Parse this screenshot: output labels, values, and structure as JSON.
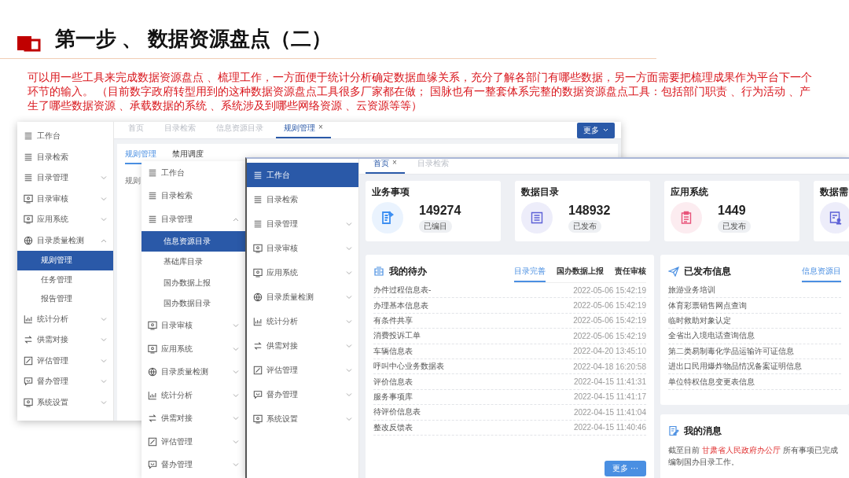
{
  "slide": {
    "title": "第一步 、 数据资源盘点（二）",
    "description": "可以用一些工具来完成数据资源盘点 、梳理工作，一方面便于统计分析确定数据血缘关系，充分了解各部门有哪些数据，另一方面需要把梳理成果作为平台下一个环节的输入。 （目前数字政府转型用到的这种数据资源盘点工具很多厂家都在做； 国脉也有一整套体系完整的数据资源盘点工具：包括部门职责 、行为活动 、产生了哪些数据资源 、承载数据的系统 、系统涉及到哪些网络资源 、云资源等等）"
  },
  "rule_window": {
    "tabs": [
      {
        "label": "首页",
        "selected": false
      },
      {
        "label": "目录检索",
        "selected": false
      },
      {
        "label": "信息资源目录",
        "selected": false
      },
      {
        "label": "规则管理",
        "close": "×",
        "selected": true
      }
    ],
    "more_button": "更多",
    "menu": [
      {
        "label": "工作台",
        "selected": false
      },
      {
        "label": "目录检索",
        "selected": false
      },
      {
        "label": "目录管理",
        "selected": false,
        "expanded": false
      },
      {
        "label": "目录审核",
        "selected": false,
        "expanded": false
      },
      {
        "label": "应用系统",
        "selected": false,
        "expanded": false
      },
      {
        "label": "目录质量检测",
        "selected": false,
        "expanded": true,
        "children": [
          {
            "label": "规则管理",
            "selected": true
          },
          {
            "label": "任务管理",
            "selected": false
          },
          {
            "label": "报告管理",
            "selected": false
          }
        ]
      },
      {
        "label": "统计分析",
        "selected": false,
        "expanded": false
      },
      {
        "label": "供需对接",
        "selected": false,
        "expanded": false
      },
      {
        "label": "评估管理",
        "selected": false,
        "expanded": false
      },
      {
        "label": "督办管理",
        "selected": false,
        "expanded": false
      },
      {
        "label": "系统设置",
        "selected": false,
        "expanded": false
      }
    ],
    "sub_tabs": [
      {
        "label": "规则管理",
        "selected": true
      },
      {
        "label": "禁用调度",
        "selected": false
      }
    ],
    "content_label": "规则"
  },
  "menu_panel": {
    "menu": [
      {
        "label": "工作台",
        "selected": false
      },
      {
        "label": "目录检索",
        "selected": false
      },
      {
        "label": "目录管理",
        "selected": false,
        "expanded": true,
        "children": [
          {
            "label": "信息资源目录",
            "selected": true
          },
          {
            "label": "基础库目录",
            "selected": false
          },
          {
            "label": "国办数据上报",
            "selected": false
          },
          {
            "label": "国办数据目录",
            "selected": false
          }
        ]
      },
      {
        "label": "目录审核",
        "selected": false,
        "expanded": false
      },
      {
        "label": "应用系统",
        "selected": false,
        "expanded": false
      },
      {
        "label": "目录质量检测",
        "selected": false,
        "expanded": false
      },
      {
        "label": "统计分析",
        "selected": false,
        "expanded": false
      },
      {
        "label": "供需对接",
        "selected": false,
        "expanded": false
      },
      {
        "label": "评估管理",
        "selected": false,
        "expanded": false
      },
      {
        "label": "督办管理",
        "selected": false,
        "expanded": false
      }
    ]
  },
  "home_window": {
    "menu": [
      {
        "label": "工作台",
        "selected": true
      },
      {
        "label": "目录检索",
        "selected": false
      },
      {
        "label": "目录管理",
        "selected": false,
        "expanded": false
      },
      {
        "label": "目录审核",
        "selected": false,
        "expanded": false
      },
      {
        "label": "应用系统",
        "selected": false,
        "expanded": false
      },
      {
        "label": "目录质量检测",
        "selected": false,
        "expanded": false
      },
      {
        "label": "统计分析",
        "selected": false,
        "expanded": false
      },
      {
        "label": "供需对接",
        "selected": false,
        "expanded": false
      },
      {
        "label": "评估管理",
        "selected": false,
        "expanded": false
      },
      {
        "label": "督办管理",
        "selected": false,
        "expanded": false
      },
      {
        "label": "系统设置",
        "selected": false,
        "expanded": false
      }
    ],
    "tabs": [
      {
        "label": "首页",
        "close": "×",
        "selected": true
      },
      {
        "label": "目录检索",
        "selected": false
      }
    ],
    "cards": [
      {
        "title": "业务事项",
        "value": "149274",
        "badge": "已编目",
        "color": "#3d8ff2"
      },
      {
        "title": "数据目录",
        "value": "148932",
        "badge": "已发布",
        "color": "#5b5fd6"
      },
      {
        "title": "应用系统",
        "value": "1449",
        "badge": "已发布",
        "color": "#e8537a"
      },
      {
        "title": "数据需",
        "color": "#5b5fd6"
      }
    ],
    "todo": {
      "title": "我的待办",
      "tabs": [
        {
          "label": "目录完善",
          "selected": true
        },
        {
          "label": "国办数据上报",
          "selected": false
        },
        {
          "label": "责任审核",
          "selected": false
        }
      ],
      "rows": [
        {
          "name": "办件过程信息表-",
          "time": "2022-05-06 15:42:19"
        },
        {
          "name": "办理基本信息表",
          "time": "2022-05-06 15:42:19"
        },
        {
          "name": "有条件共享",
          "time": "2022-05-06 15:42:19"
        },
        {
          "name": "消费投诉工单",
          "time": "2022-05-06 15:42:19"
        },
        {
          "name": "车辆信息表",
          "time": "2022-04-20 13:45:10"
        },
        {
          "name": "呼叫中心业务数据表",
          "time": "2022-04-18 16:20:58"
        },
        {
          "name": "评价信息表",
          "time": "2022-04-15 11:41:31"
        },
        {
          "name": "服务事项库",
          "time": "2022-04-15 11:41:17"
        },
        {
          "name": "待评价信息表",
          "time": "2022-04-15 11:41:04"
        },
        {
          "name": "整改反馈表",
          "time": "2022-04-15 11:40:46"
        }
      ],
      "more_button": "更多 ···"
    },
    "published": {
      "title": "已发布信息",
      "tabs": [
        {
          "label": "信息资源目",
          "selected": true
        }
      ],
      "rows": [
        "旅游业务培训",
        "体育彩票销售网点查询",
        "临时救助对象认定",
        "全省出入境电话查询信息",
        "第二类易制毒化学品运输许可证信息",
        "进出口民用爆炸物品情况备案证明信息",
        "单位特权信息变更表信息"
      ]
    },
    "messages": {
      "title": "我的消息",
      "text_parts": [
        {
          "text": "截至目前 ",
          "highlight": false
        },
        {
          "text": "甘肃省人民政府办公厅",
          "highlight": true
        },
        {
          "text": " 所有事项已完成编制国办目录工作。",
          "highlight": false
        }
      ]
    }
  }
}
